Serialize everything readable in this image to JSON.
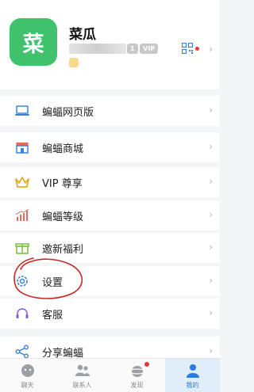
{
  "profile": {
    "avatar_char": "菜",
    "name": "菜瓜",
    "badge_level": "1",
    "badge_vip": "VIP",
    "chevron": "›"
  },
  "menu": [
    {
      "label": "蝙蝠网页版",
      "icon": "laptop-icon"
    },
    {
      "label": "蝙蝠商城",
      "icon": "store-icon"
    },
    {
      "label": "VIP 尊享",
      "icon": "crown-icon"
    },
    {
      "label": "蝙蝠等级",
      "icon": "level-chart-icon"
    },
    {
      "label": "邀新福利",
      "icon": "gift-icon"
    },
    {
      "label": "设置",
      "icon": "settings-gear-icon"
    },
    {
      "label": "客服",
      "icon": "headset-icon"
    },
    {
      "label": "分享蝙蝠",
      "icon": "share-icon"
    }
  ],
  "chevron": "›",
  "tabs": [
    {
      "label": "聊天",
      "icon": "chat-bat-icon"
    },
    {
      "label": "联系人",
      "icon": "contacts-icon"
    },
    {
      "label": "发现",
      "icon": "planet-icon"
    },
    {
      "label": "我的",
      "icon": "person-icon"
    }
  ],
  "colors": {
    "accent_green": "#3fc26b",
    "accent_blue": "#2a7be0",
    "annotation_red": "#c62828",
    "red_dot": "#e53935"
  }
}
